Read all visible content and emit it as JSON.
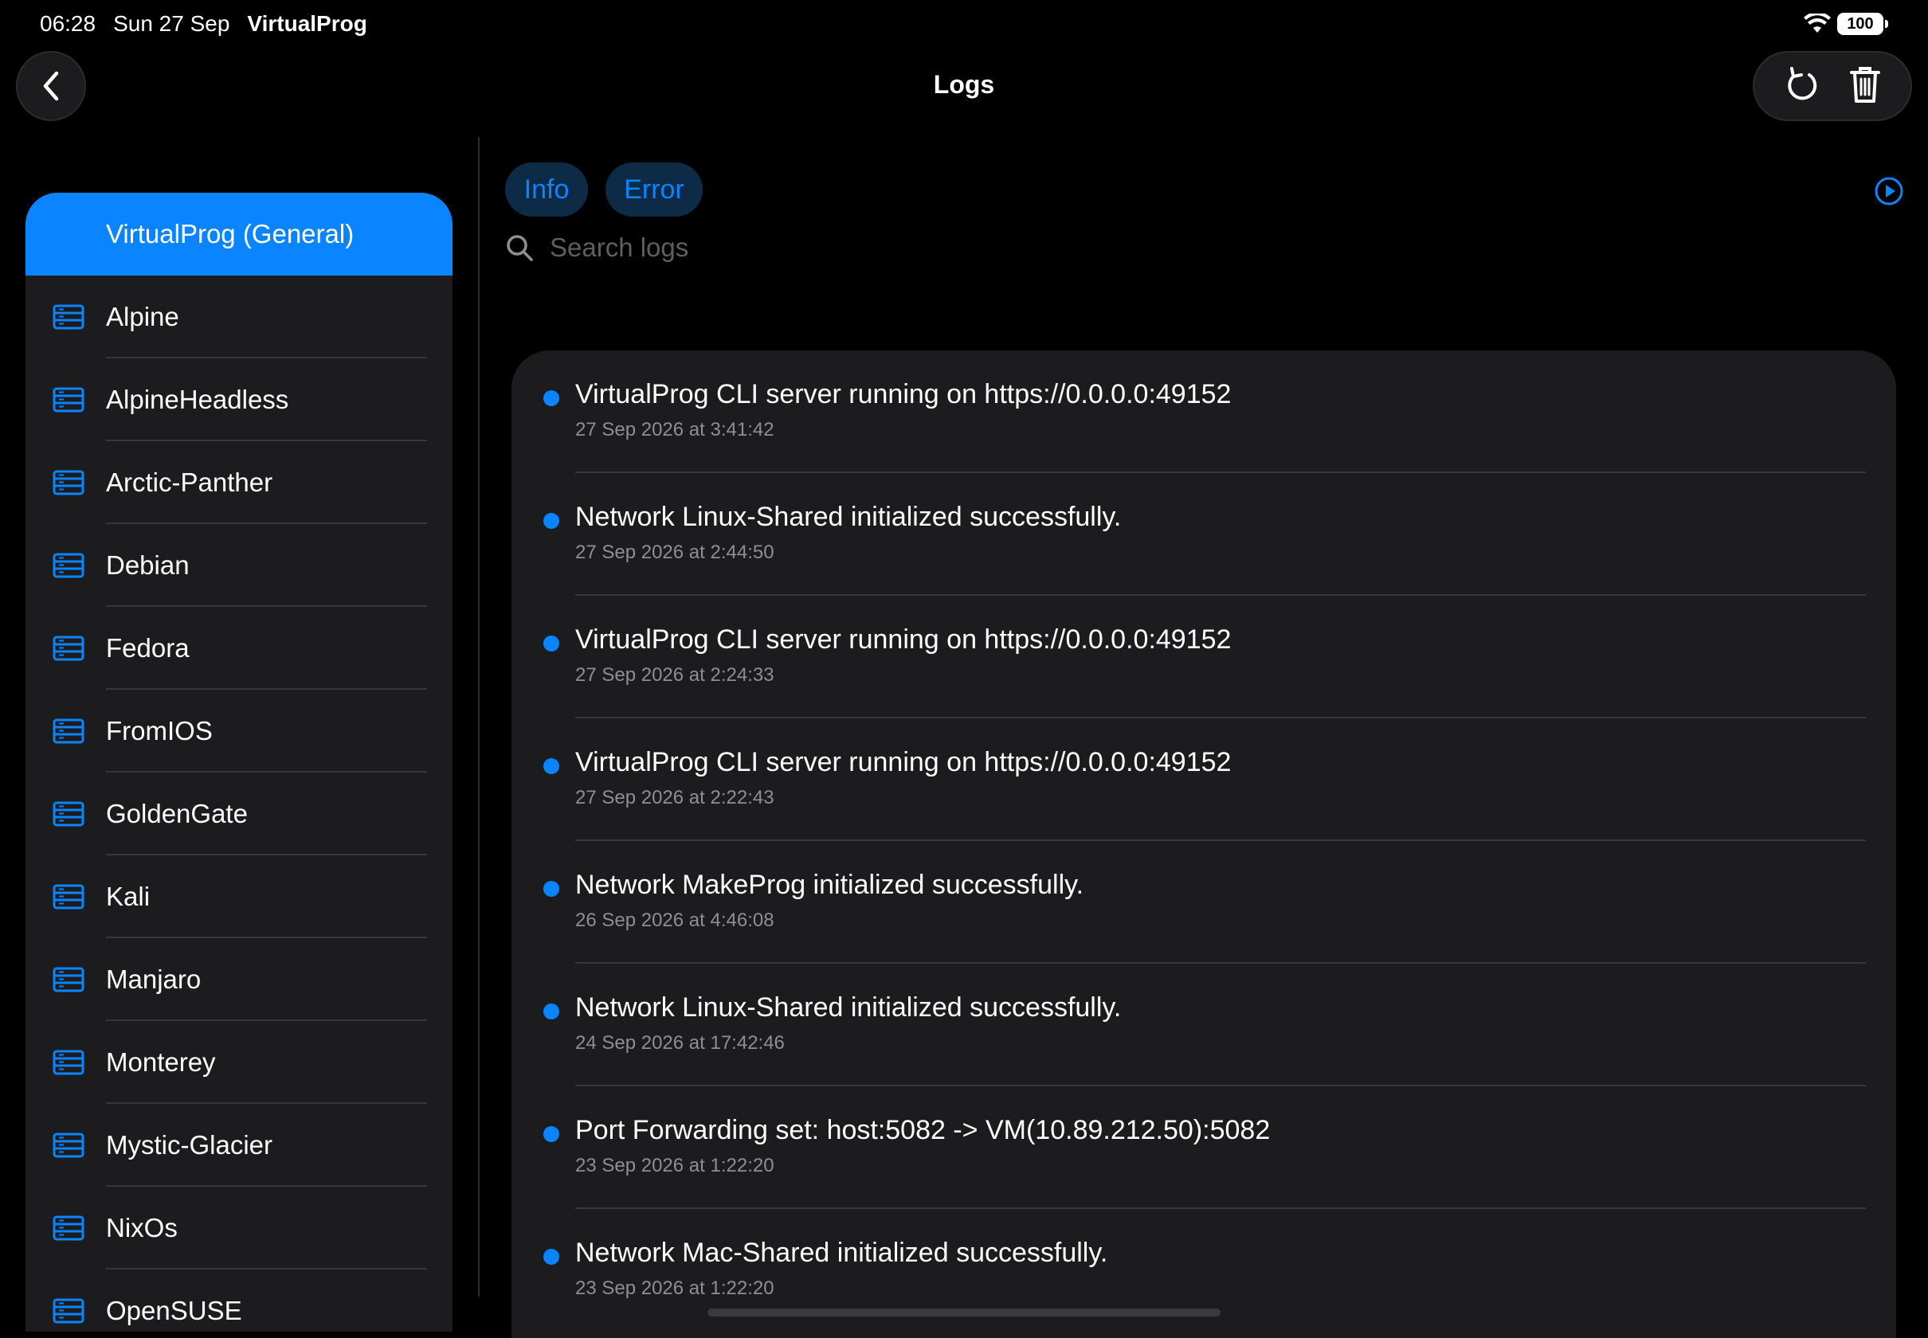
{
  "status_bar": {
    "time": "06:28",
    "date": "Sun 27 Sep",
    "app": "VirtualProg",
    "battery": "100"
  },
  "nav": {
    "title": "Logs"
  },
  "sidebar": {
    "items": [
      {
        "label": "VirtualProg (General)",
        "selected": true
      },
      {
        "label": "Alpine"
      },
      {
        "label": "AlpineHeadless"
      },
      {
        "label": "Arctic-Panther"
      },
      {
        "label": "Debian"
      },
      {
        "label": "Fedora"
      },
      {
        "label": "FromIOS"
      },
      {
        "label": "GoldenGate"
      },
      {
        "label": "Kali"
      },
      {
        "label": "Manjaro"
      },
      {
        "label": "Monterey"
      },
      {
        "label": "Mystic-Glacier"
      },
      {
        "label": "NixOs"
      },
      {
        "label": "OpenSUSE"
      }
    ]
  },
  "filters": {
    "info": "Info",
    "error": "Error"
  },
  "search": {
    "placeholder": "Search logs"
  },
  "logs": [
    {
      "message": "VirtualProg CLI server running on https://0.0.0.0:49152",
      "timestamp": "27 Sep 2026 at 3:41:42"
    },
    {
      "message": "Network Linux-Shared initialized successfully.",
      "timestamp": "27 Sep 2026 at 2:44:50"
    },
    {
      "message": "VirtualProg CLI server running on https://0.0.0.0:49152",
      "timestamp": "27 Sep 2026 at 2:24:33"
    },
    {
      "message": "VirtualProg CLI server running on https://0.0.0.0:49152",
      "timestamp": "27 Sep 2026 at 2:22:43"
    },
    {
      "message": "Network MakeProg initialized successfully.",
      "timestamp": "26 Sep 2026 at 4:46:08"
    },
    {
      "message": "Network Linux-Shared initialized successfully.",
      "timestamp": "24 Sep 2026 at 17:42:46"
    },
    {
      "message": "Port Forwarding set: host:5082 -> VM(10.89.212.50):5082",
      "timestamp": "23 Sep 2026 at 1:22:20"
    },
    {
      "message": "Network Mac-Shared initialized successfully.",
      "timestamp": "23 Sep 2026 at 1:22:20"
    }
  ],
  "colors": {
    "accent": "#0a84ff",
    "card": "#1c1c1e",
    "background": "#000000"
  }
}
